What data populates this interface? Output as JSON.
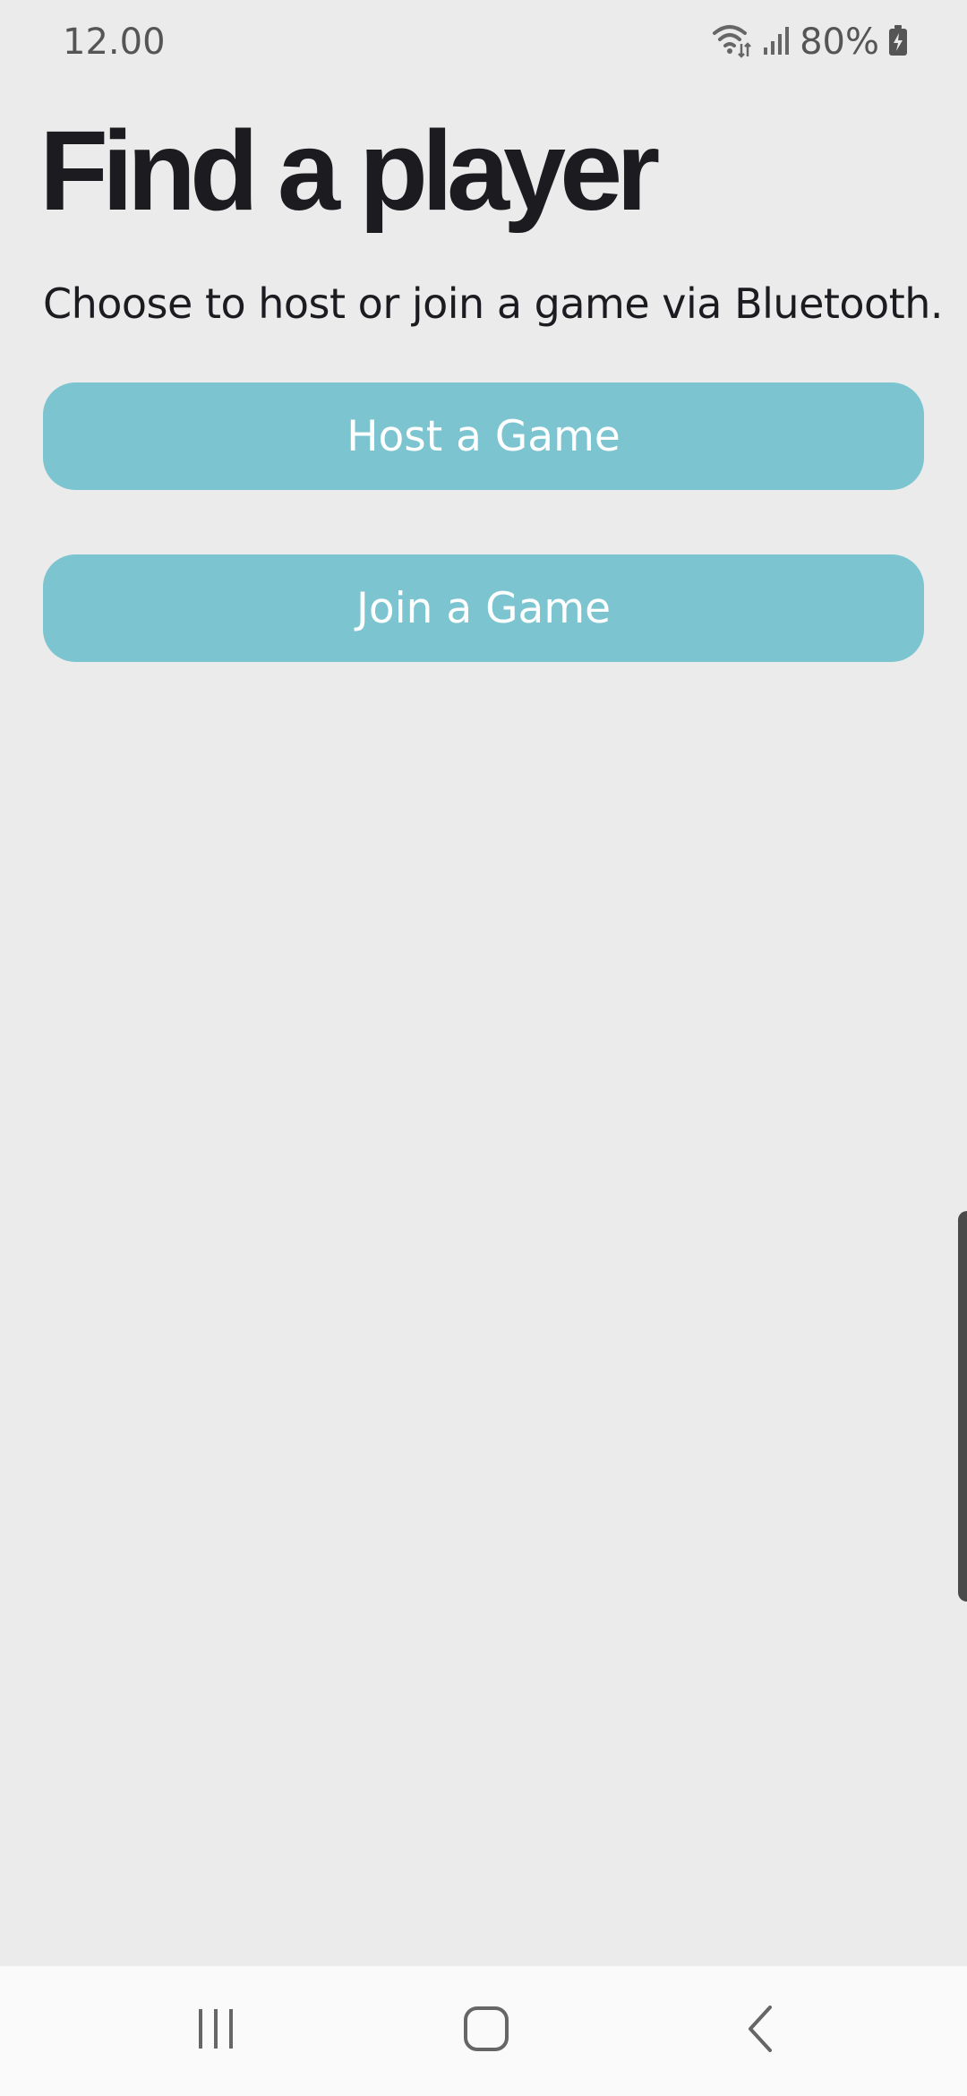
{
  "status_bar": {
    "time": "12.00",
    "battery_percent": "80%",
    "icons": [
      "wifi-icon",
      "signal-icon",
      "battery-charging-icon"
    ]
  },
  "header": {
    "title": "Find a player",
    "subtitle": "Choose to host or join a game via Bluetooth."
  },
  "actions": {
    "host_label": "Host a Game",
    "join_label": "Join a Game"
  },
  "nav_bar": {
    "icons": [
      "recents-icon",
      "home-icon",
      "back-icon"
    ]
  },
  "colors": {
    "background": "#ebebeb",
    "button": "#7cc5d0",
    "button_text": "#ffffff",
    "title_text": "#1c1b20"
  }
}
